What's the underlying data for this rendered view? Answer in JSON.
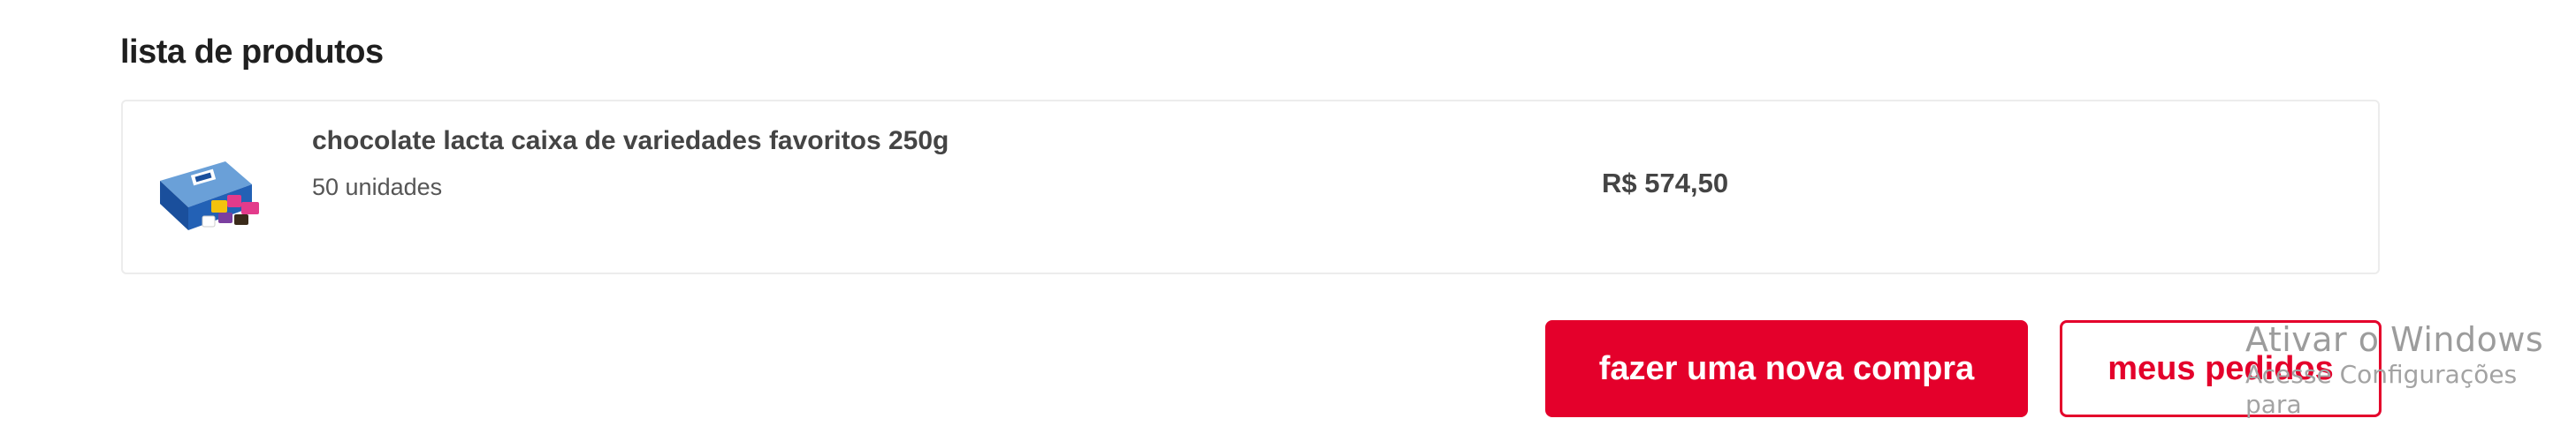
{
  "section": {
    "title": "lista de produtos"
  },
  "product": {
    "name": "chocolate lacta caixa de variedades favoritos 250g",
    "quantity": "50 unidades",
    "price": "R$ 574,50",
    "thumbnail_icon": "lacta-box-image"
  },
  "actions": {
    "new_purchase_label": "fazer uma nova compra",
    "my_orders_label": "meus pedidos"
  },
  "watermark": {
    "title": "Ativar o Windows",
    "subtitle": "Acesse Configurações para"
  },
  "colors": {
    "accent": "#e4002b",
    "text": "#444444",
    "border": "#ececec"
  }
}
